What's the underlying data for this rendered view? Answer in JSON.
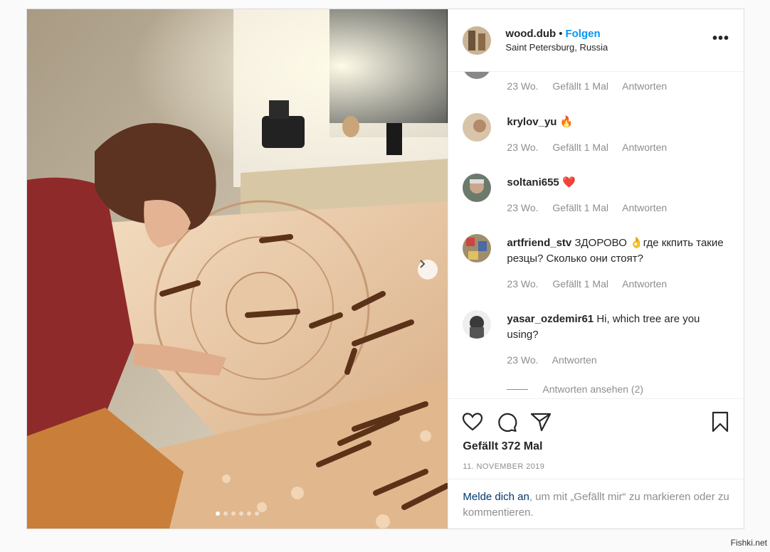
{
  "post": {
    "username": "wood.dub",
    "separator": "•",
    "follow_label": "Folgen",
    "location": "Saint Petersburg, Russia",
    "more_label": "•••"
  },
  "comments": [
    {
      "meta_time": "23 Wo.",
      "meta_likes": "Gefällt 1 Mal",
      "meta_reply": "Antworten"
    },
    {
      "user": "krylov_yu",
      "text": "🔥",
      "meta_time": "23 Wo.",
      "meta_likes": "Gefällt 1 Mal",
      "meta_reply": "Antworten"
    },
    {
      "user": "soltani655",
      "text": "❤️",
      "meta_time": "23 Wo.",
      "meta_likes": "Gefällt 1 Mal",
      "meta_reply": "Antworten"
    },
    {
      "user": "artfriend_stv",
      "text": "ЗДОРОВО 👌где ккпить такие резцы? Сколько они стоят?",
      "meta_time": "23 Wo.",
      "meta_likes": "Gefällt 1 Mal",
      "meta_reply": "Antworten"
    },
    {
      "user": "yasar_ozdemir61",
      "text": "Hi, which tree are you using?",
      "meta_time": "23 Wo.",
      "meta_reply": "Antworten"
    }
  ],
  "view_replies": "Antworten ansehen (2)",
  "likes_text": "Gefällt 372 Mal",
  "date_text": "11. NOVEMBER 2019",
  "login": {
    "link": "Melde dich an",
    "rest": ", um mit „Gefällt mir“ zu markieren oder zu kommentieren."
  },
  "carousel": {
    "count": 6,
    "active": 0
  },
  "watermark": "Fishki.net",
  "icons": [
    "heart-icon",
    "comment-icon",
    "share-icon",
    "bookmark-icon",
    "chevron-right-icon",
    "more-icon"
  ],
  "colors": {
    "link_blue": "#0095f6",
    "meta_gray": "#8e8e8e",
    "text": "#262626"
  }
}
